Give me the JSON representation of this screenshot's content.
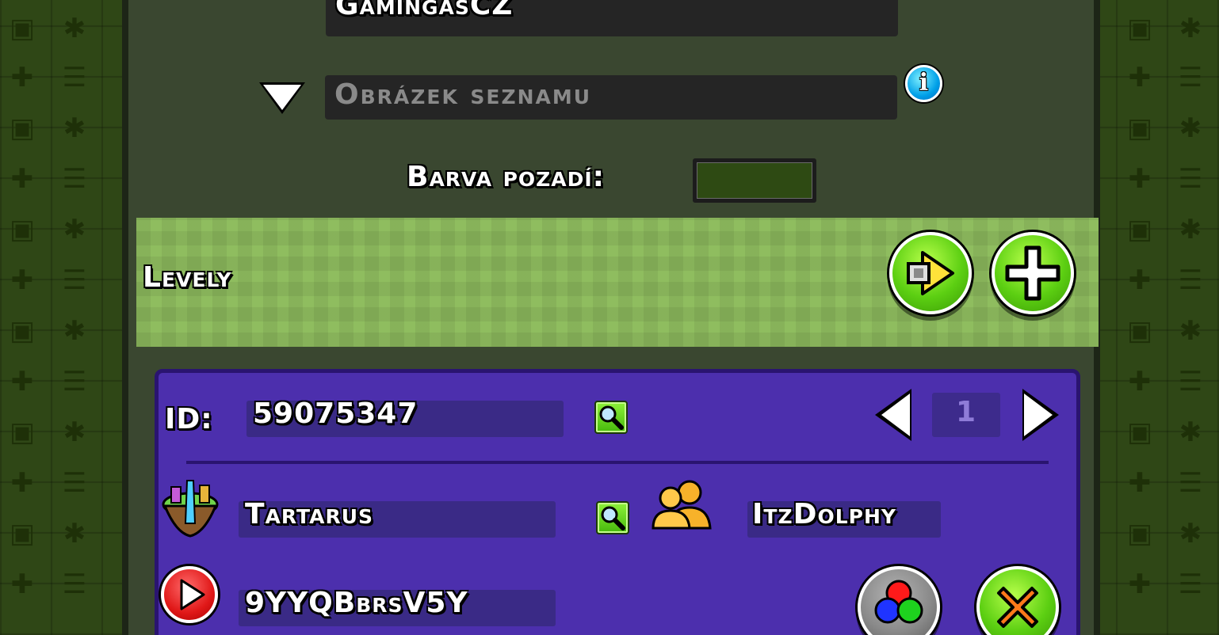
{
  "header": {
    "creator_name": "GamingasCZ",
    "list_image_placeholder": "Obrázek seznamu",
    "background_color_label": "Barva pozadí:",
    "background_color_value": "#2e4a13"
  },
  "levels_section": {
    "title": "Levely",
    "play_icon": "play-icon",
    "add_icon": "plus-icon"
  },
  "level_card": {
    "id_label": "ID:",
    "id_value": "59075347",
    "page_number": "1",
    "level_name": "Tartarus",
    "creator_value": "ItzDolphy",
    "video_id": "9YYQBbrsV5Y",
    "icons": {
      "search": "magnifier-icon",
      "level_icon": "floating-island-icon",
      "creator": "users-icon",
      "video": "youtube-play-icon",
      "color": "rgb-circles-icon",
      "delete": "x-icon"
    }
  },
  "colors": {
    "panel_green": "#3a4730",
    "band_green": "#8fbd5f",
    "purple": "#4c2fad",
    "button_green": "#5ccf12"
  }
}
